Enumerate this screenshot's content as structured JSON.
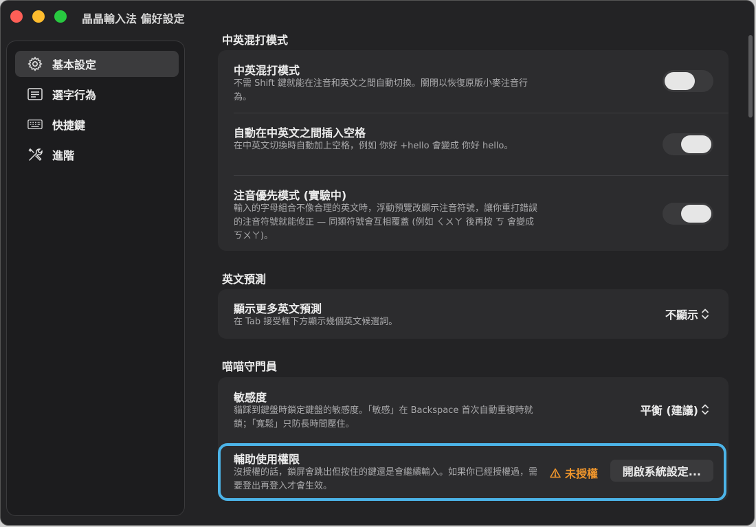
{
  "window": {
    "title": "晶晶輸入法 偏好設定"
  },
  "sidebar": {
    "items": [
      {
        "label": "基本設定",
        "icon": "gear-icon",
        "active": true
      },
      {
        "label": "選字行為",
        "icon": "list-icon",
        "active": false
      },
      {
        "label": "快捷鍵",
        "icon": "keyboard-icon",
        "active": false
      },
      {
        "label": "進階",
        "icon": "tools-icon",
        "active": false
      }
    ]
  },
  "sections": {
    "mixed": {
      "title": "中英混打模式",
      "rows": [
        {
          "title": "中英混打模式",
          "desc": "不需 Shift 鍵就能在注音和英文之間自動切換。關閉以恢復原版小麥注音行為。",
          "toggle": "off"
        },
        {
          "title": "自動在中英文之間插入空格",
          "desc": "在中英文切換時自動加上空格，例如 你好 +hello 會變成 你好 hello。",
          "toggle": "on"
        },
        {
          "title": "注音優先模式 (實驗中)",
          "desc": "輸入的字母組合不像合理的英文時，浮動預覽改顯示注音符號，讓你重打錯誤的注音符號就能修正 — 同類符號會互相覆蓋 (例如 ㄑㄨㄚ 後再按 ㄎ 會變成 ㄎㄨㄚ)。",
          "toggle": "on"
        }
      ]
    },
    "prediction": {
      "title": "英文預測",
      "rows": [
        {
          "title": "顯示更多英文預測",
          "desc": "在 Tab 接受框下方顯示幾個英文候選詞。",
          "value": "不顯示"
        }
      ]
    },
    "guard": {
      "title": "喵喵守門員",
      "rows": [
        {
          "title": "敏感度",
          "desc": "貓踩到鍵盤時鎖定鍵盤的敏感度。「敏感」在 Backspace 首次自動重複時就鎖；「寬鬆」只防長時間壓住。",
          "value": "平衡 (建議)"
        },
        {
          "title": "輔助使用權限",
          "desc": "沒授權的話，鎖屏會跳出但按住的鍵還是會繼續輸入。如果你已經授權過，需要登出再登入才會生效。",
          "status": "未授權",
          "button": "開啟系統設定..."
        }
      ]
    }
  },
  "colors": {
    "highlight": "#4cb4e8",
    "warning": "#f0962c",
    "window_bg": "#232325",
    "card_bg": "#2c2c2e"
  }
}
